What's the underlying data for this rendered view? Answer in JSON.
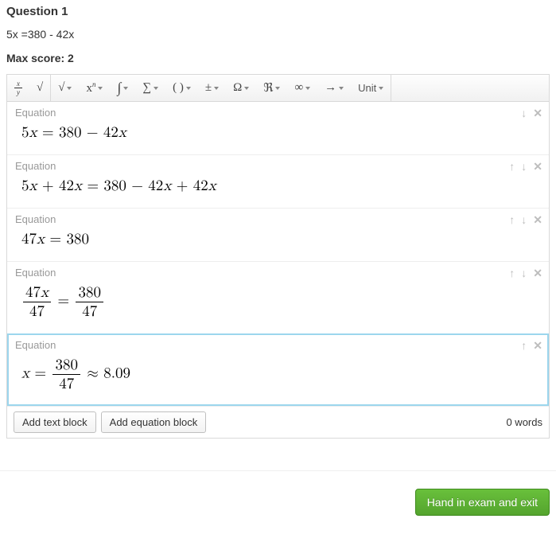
{
  "question": {
    "title": "Question 1",
    "body": "5x =380 - 42x",
    "max_score_label": "Max score: 2"
  },
  "toolbar": {
    "unit_label": "Unit"
  },
  "blocks": [
    {
      "label": "Equation",
      "html": "5<span class='it'>x</span> = 380 − 42<span class='it'>x</span>",
      "text": "5x = 380 - 42x",
      "up": false,
      "down": true,
      "del": true,
      "active": false
    },
    {
      "label": "Equation",
      "html": "5<span class='it'>x</span> + 42<span class='it'>x</span> = 380 − 42<span class='it'>x</span> + 42<span class='it'>x</span>",
      "text": "5x + 42x = 380 - 42x + 42x",
      "up": true,
      "down": true,
      "del": true,
      "active": false
    },
    {
      "label": "Equation",
      "html": "47<span class='it'>x</span> = 380",
      "text": "47x = 380",
      "up": true,
      "down": true,
      "del": true,
      "active": false
    },
    {
      "label": "Equation",
      "html": "<span class='mfrac'><span class='num'>47<span class='it'>x</span></span><span class='den'>47</span></span> = <span class='mfrac'><span class='num'>380</span><span class='den'>47</span></span>",
      "text": "47x/47 = 380/47",
      "up": true,
      "down": true,
      "del": true,
      "active": false
    },
    {
      "label": "Equation",
      "html": "<span class='it'>x</span> = <span class='mfrac'><span class='num'>380</span><span class='den'>47</span></span> ≈ 8.09",
      "text": "x = 380/47 ≈ 8.09",
      "up": true,
      "down": false,
      "del": true,
      "active": true
    }
  ],
  "footer": {
    "add_text": "Add text block",
    "add_eq": "Add equation block",
    "wordcount": "0 words"
  },
  "handin": "Hand in exam and exit"
}
